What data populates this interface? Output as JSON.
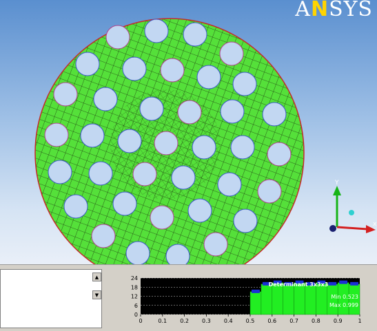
{
  "logo": {
    "text_a": "A",
    "text_n": "N",
    "text_rest": "SYS"
  },
  "triad": {
    "y_label": "Y",
    "x_label": "x"
  },
  "messages": {
    "items": []
  },
  "colors": {
    "mesh": "#55e03a",
    "edge": "#c62828",
    "hole": "#c2d7f2",
    "bar": "#22ee22",
    "bar_cap": "#1b2fd6"
  },
  "chart_data": {
    "type": "bar",
    "title": "Determinant 3x3x3",
    "xlabel": "",
    "ylabel": "",
    "xlim": [
      0,
      1
    ],
    "ylim": [
      0,
      24
    ],
    "y_ticks": [
      0,
      6,
      12,
      18,
      24
    ],
    "x_ticks": [
      "0",
      "0.1",
      "0.2",
      "0.3",
      "0.4",
      "0.5",
      "0.6",
      "0.7",
      "0.8",
      "0.9",
      "1"
    ],
    "bins": [
      {
        "x0": 0.5,
        "x1": 0.55,
        "value": 15
      },
      {
        "x0": 0.55,
        "x1": 0.6,
        "value": 20
      },
      {
        "x0": 0.6,
        "x1": 0.65,
        "value": 21
      },
      {
        "x0": 0.65,
        "x1": 0.7,
        "value": 20
      },
      {
        "x0": 0.7,
        "x1": 0.75,
        "value": 21
      },
      {
        "x0": 0.75,
        "x1": 0.8,
        "value": 20
      },
      {
        "x0": 0.8,
        "x1": 0.85,
        "value": 21
      },
      {
        "x0": 0.85,
        "x1": 0.9,
        "value": 20
      },
      {
        "x0": 0.9,
        "x1": 0.95,
        "value": 21
      },
      {
        "x0": 0.95,
        "x1": 1.0,
        "value": 20
      }
    ],
    "stats": {
      "min_label": "Min 0.523",
      "max_label": "Max 0.999"
    }
  }
}
